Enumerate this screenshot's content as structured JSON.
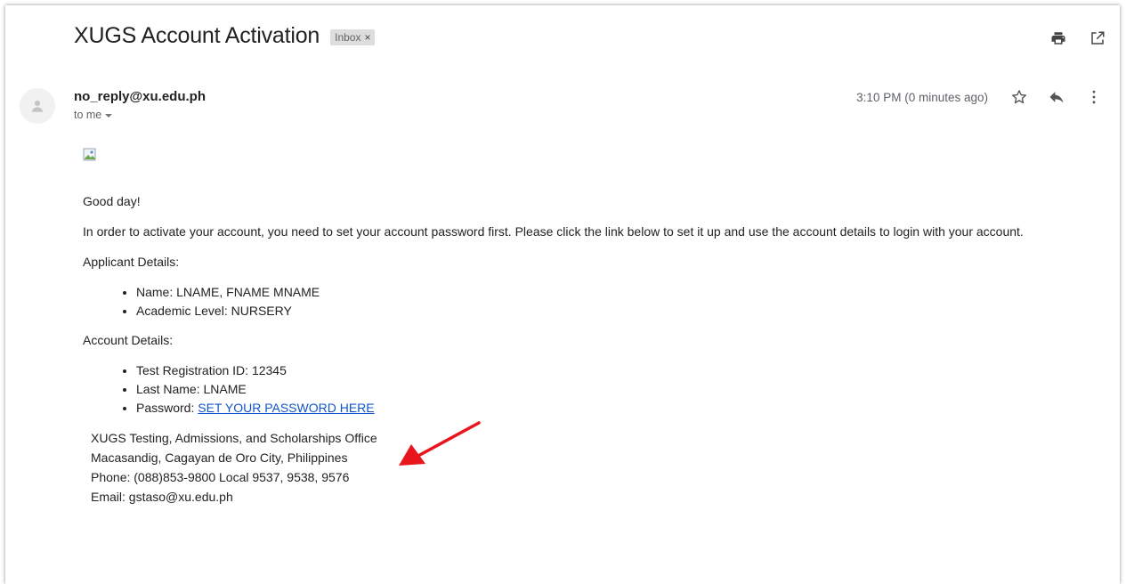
{
  "email": {
    "subject": "XUGS Account Activation",
    "label": "Inbox",
    "label_close": "×",
    "sender": "no_reply@xu.edu.ph",
    "recipient_summary": "to me",
    "timestamp": "3:10 PM (0 minutes ago)"
  },
  "toolbar": {
    "icons": [
      "print-icon",
      "open-in-new-window-icon"
    ]
  },
  "message_actions": {
    "icons": [
      "star-icon",
      "reply-icon",
      "more-vert-icon"
    ]
  },
  "body": {
    "greeting": "Good day!",
    "intro": "In order to activate your account, you need to set your account password first. Please click the link below to set it up and use the account details to login with your account.",
    "applicant_heading": "Applicant Details:",
    "applicant_items": [
      "Name: LNAME, FNAME MNAME",
      "Academic Level: NURSERY"
    ],
    "account_heading": "Account Details:",
    "account_items": [
      "Test Registration ID: 12345",
      "Last Name: LNAME"
    ],
    "password_prefix": "Password: ",
    "password_link": "SET YOUR PASSWORD HERE",
    "signature": [
      "XUGS Testing, Admissions, and Scholarships Office",
      "Macasandig, Cagayan de Oro City, Philippines",
      "Phone: (088)853-9800 Local 9537, 9538, 9576",
      "Email: gstaso@xu.edu.ph"
    ]
  },
  "colors": {
    "link": "#1155cc",
    "arrow": "#e8161c",
    "chip_bg": "#dddddd"
  }
}
